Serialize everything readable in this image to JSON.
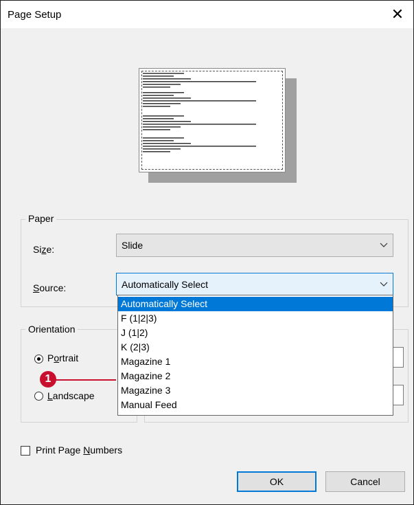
{
  "window": {
    "title": "Page Setup",
    "close_glyph": "✕"
  },
  "paper": {
    "legend": "Paper",
    "size_label_pre": "Si",
    "size_label_u": "z",
    "size_label_post": "e:",
    "size_value": "Slide",
    "source_label_u": "S",
    "source_label_post": "ource:",
    "source_value": "Automatically Select",
    "source_options": [
      "Automatically Select",
      "F (1|2|3)",
      "J (1|2)",
      "K (2|3)",
      "Magazine 1",
      "Magazine 2",
      "Magazine 3",
      "Manual Feed"
    ],
    "selected_option": "Automatically Select"
  },
  "orientation": {
    "legend": "Orientation",
    "portrait_pre": "P",
    "portrait_u": "o",
    "portrait_post": "rtrait",
    "landscape_u": "L",
    "landscape_post": "andscape",
    "selected": "Portrait"
  },
  "print_page_numbers": {
    "label_pre": "Print Page ",
    "label_u": "N",
    "label_post": "umbers",
    "checked": false
  },
  "buttons": {
    "ok": "OK",
    "cancel": "Cancel"
  },
  "callout": {
    "number": "1"
  },
  "colors": {
    "accent": "#0078d7",
    "callout": "#c8102e"
  }
}
